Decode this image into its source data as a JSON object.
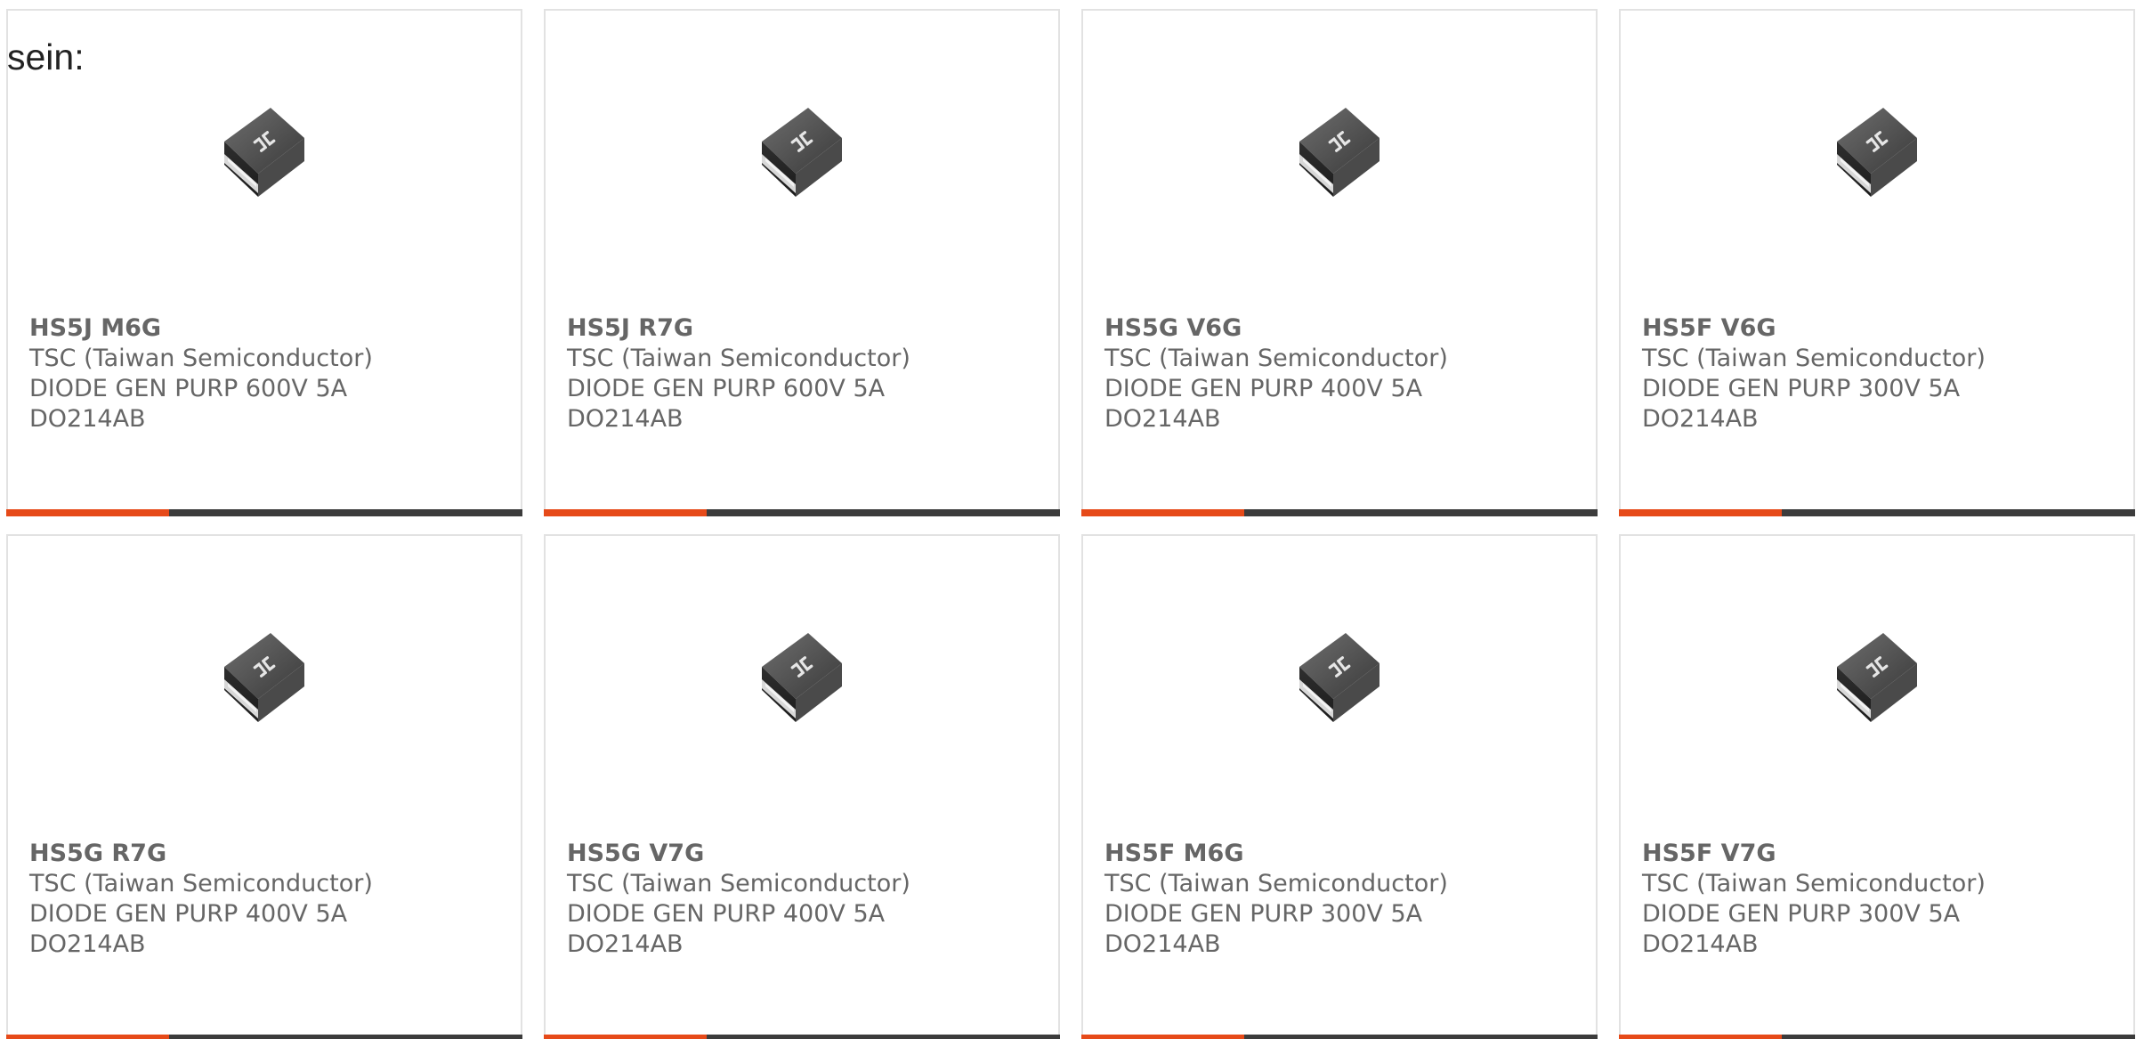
{
  "heading": "sein:",
  "colors": {
    "accent": "#e64a19",
    "bar": "#3c3c3c",
    "text": "#666666",
    "border": "#e2e2e2"
  },
  "image_icon": "smd-diode-package-icon",
  "products": [
    {
      "part": "HS5J M6G",
      "manufacturer": "TSC (Taiwan Semiconductor)",
      "desc1": "DIODE GEN PURP 600V 5A",
      "desc2": "DO214AB"
    },
    {
      "part": "HS5J R7G",
      "manufacturer": "TSC (Taiwan Semiconductor)",
      "desc1": "DIODE GEN PURP 600V 5A",
      "desc2": "DO214AB"
    },
    {
      "part": "HS5G V6G",
      "manufacturer": "TSC (Taiwan Semiconductor)",
      "desc1": "DIODE GEN PURP 400V 5A",
      "desc2": "DO214AB"
    },
    {
      "part": "HS5F V6G",
      "manufacturer": "TSC (Taiwan Semiconductor)",
      "desc1": "DIODE GEN PURP 300V 5A",
      "desc2": "DO214AB"
    },
    {
      "part": "HS5G R7G",
      "manufacturer": "TSC (Taiwan Semiconductor)",
      "desc1": "DIODE GEN PURP 400V 5A",
      "desc2": "DO214AB"
    },
    {
      "part": "HS5G V7G",
      "manufacturer": "TSC (Taiwan Semiconductor)",
      "desc1": "DIODE GEN PURP 400V 5A",
      "desc2": "DO214AB"
    },
    {
      "part": "HS5F M6G",
      "manufacturer": "TSC (Taiwan Semiconductor)",
      "desc1": "DIODE GEN PURP 300V 5A",
      "desc2": "DO214AB"
    },
    {
      "part": "HS5F V7G",
      "manufacturer": "TSC (Taiwan Semiconductor)",
      "desc1": "DIODE GEN PURP 300V 5A",
      "desc2": "DO214AB"
    }
  ]
}
